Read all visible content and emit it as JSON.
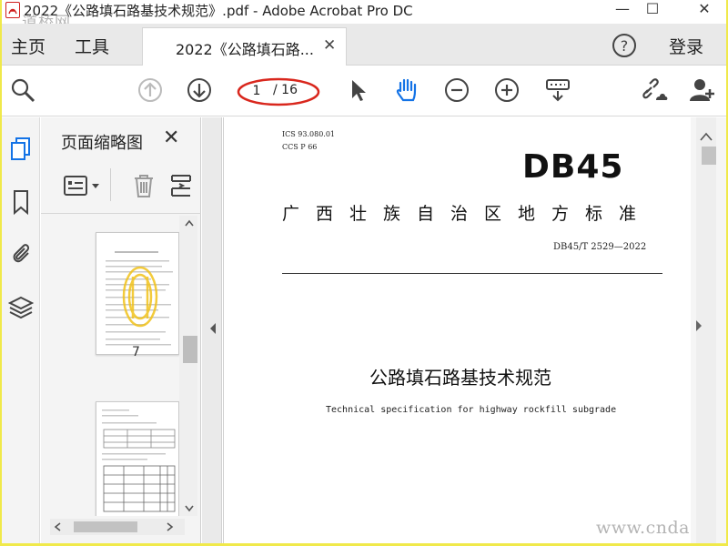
{
  "window": {
    "title": "2022《公路填石路基技术规范》.pdf - Adobe Acrobat Pro DC",
    "watermark_top": "道桥网",
    "minimize_label": "—",
    "maximize_label": "☐",
    "close_label": "✕"
  },
  "nav": {
    "home": "主页",
    "tools": "工具",
    "tab_label": "2022《公路填石路...",
    "tab_close": "✕",
    "sign_in": "登录"
  },
  "toolbar": {
    "page_current": "1",
    "page_total": "/ 16",
    "highlight_color": "#d9271d",
    "accent_color": "#1473e6"
  },
  "thumbnails": {
    "title": "页面缩略图",
    "close": "✕",
    "page_label": "7"
  },
  "document": {
    "ics": "ICS  93.080.01",
    "ccs": "CCS  P  66",
    "logo": "DB45",
    "standard_type": "广西壮族自治区地方标准",
    "standard_number": "DB45/T 2529—2022",
    "title_cn": "公路填石路基技术规范",
    "title_en": "Technical specification for highway rockfill subgrade"
  },
  "watermark_bottom": "www.cndao.com"
}
